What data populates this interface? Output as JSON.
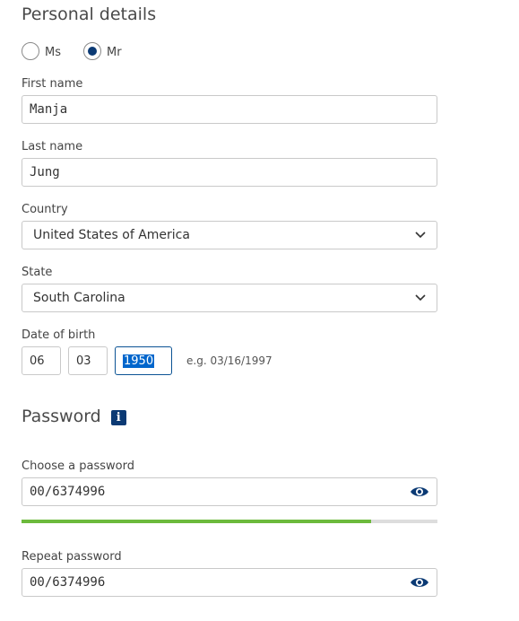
{
  "personal": {
    "title": "Personal details",
    "salutation": {
      "options": [
        "Ms",
        "Mr"
      ],
      "selected": "Mr"
    },
    "first_name": {
      "label": "First name",
      "value": "Manja"
    },
    "last_name": {
      "label": "Last name",
      "value": "Jung"
    },
    "country": {
      "label": "Country",
      "value": "United States of America"
    },
    "state": {
      "label": "State",
      "value": "South Carolina"
    },
    "dob": {
      "label": "Date of birth",
      "month": "06",
      "day": "03",
      "year": "1950",
      "hint": "e.g. 03/16/1997"
    }
  },
  "password": {
    "title": "Password",
    "info_icon": "info-icon",
    "choose": {
      "label": "Choose a password",
      "value": "00/6374996"
    },
    "strength_fraction": 0.84,
    "repeat": {
      "label": "Repeat password",
      "value": "00/6374996"
    }
  },
  "colors": {
    "accent": "#0b3a74",
    "strength": "#6cba3c",
    "strength_track": "#dddddd"
  }
}
